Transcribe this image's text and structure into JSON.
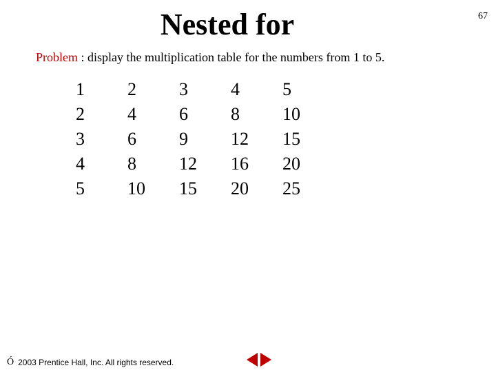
{
  "page_number": "67",
  "title": "Nested for",
  "problem": {
    "label": "Problem",
    "text": " : display the multiplication table for the numbers from 1 to 5."
  },
  "chart_data": {
    "type": "table",
    "rows": [
      [
        "1",
        "2",
        "3",
        "4",
        "5"
      ],
      [
        "2",
        "4",
        "6",
        "8",
        "10"
      ],
      [
        "3",
        "6",
        "9",
        "12",
        "15"
      ],
      [
        "4",
        "8",
        "12",
        "16",
        "20"
      ],
      [
        "5",
        "10",
        "15",
        "20",
        "25"
      ]
    ]
  },
  "footer": {
    "copyright_symbol": "Ó",
    "text": "2003 Prentice Hall, Inc. All rights reserved."
  }
}
